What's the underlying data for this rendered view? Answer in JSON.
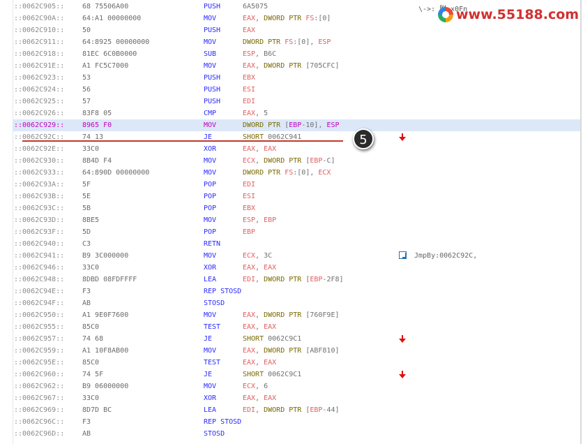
{
  "rows": [
    {
      "addr": "::0062C905::",
      "bytes": "68 75506A00",
      "mn": "PUSH",
      "ops": [
        [
          "num",
          "6A5075"
        ]
      ],
      "mark": ""
    },
    {
      "addr": "::0062C90A::",
      "bytes": "64:A1 00000000",
      "mn": "MOV",
      "ops": [
        [
          "reg",
          "EAX"
        ],
        [
          "num",
          ", "
        ],
        [
          "kw",
          "DWORD PTR "
        ],
        [
          "reg",
          "FS"
        ],
        [
          "num",
          ":[0]"
        ]
      ],
      "mark": ""
    },
    {
      "addr": "::0062C910::",
      "bytes": "50",
      "mn": "PUSH",
      "ops": [
        [
          "reg",
          "EAX"
        ]
      ],
      "mark": ""
    },
    {
      "addr": "::0062C911::",
      "bytes": "64:8925 00000000",
      "mn": "MOV",
      "ops": [
        [
          "kw",
          "DWORD PTR "
        ],
        [
          "reg",
          "FS"
        ],
        [
          "num",
          ":[0], "
        ],
        [
          "reg",
          "ESP"
        ]
      ],
      "mark": ""
    },
    {
      "addr": "::0062C918::",
      "bytes": "81EC 6C0B0000",
      "mn": "SUB",
      "ops": [
        [
          "reg",
          "ESP"
        ],
        [
          "num",
          ", B6C"
        ]
      ],
      "mark": ""
    },
    {
      "addr": "::0062C91E::",
      "bytes": "A1 FC5C7000",
      "mn": "MOV",
      "ops": [
        [
          "reg",
          "EAX"
        ],
        [
          "num",
          ", "
        ],
        [
          "kw",
          "DWORD PTR "
        ],
        [
          "num",
          "[705CFC]"
        ]
      ],
      "mark": ""
    },
    {
      "addr": "::0062C923::",
      "bytes": "53",
      "mn": "PUSH",
      "ops": [
        [
          "reg",
          "EBX"
        ]
      ],
      "mark": ""
    },
    {
      "addr": "::0062C924::",
      "bytes": "56",
      "mn": "PUSH",
      "ops": [
        [
          "reg",
          "ESI"
        ]
      ],
      "mark": ""
    },
    {
      "addr": "::0062C925::",
      "bytes": "57",
      "mn": "PUSH",
      "ops": [
        [
          "reg",
          "EDI"
        ]
      ],
      "mark": ""
    },
    {
      "addr": "::0062C926::",
      "bytes": "83F8 05",
      "mn": "CMP",
      "ops": [
        [
          "reg",
          "EAX"
        ],
        [
          "num",
          ", 5"
        ]
      ],
      "mark": ""
    },
    {
      "addr": "::0062C929::",
      "bytes": "8965 F0",
      "mn": "MOV",
      "ops": [
        [
          "kw",
          "DWORD PTR "
        ],
        [
          "num",
          "["
        ],
        [
          "reg",
          "EBP"
        ],
        [
          "num",
          "-10], "
        ],
        [
          "reg",
          "ESP"
        ]
      ],
      "mark": "",
      "hl": true
    },
    {
      "addr": "::0062C92C::",
      "bytes": "74 13",
      "mn": "JE",
      "ops": [
        [
          "kw",
          "SHORT "
        ],
        [
          "num",
          "0062C941"
        ]
      ],
      "mark": "arrow"
    },
    {
      "addr": "::0062C92E::",
      "bytes": "33C0",
      "mn": "XOR",
      "ops": [
        [
          "reg",
          "EAX"
        ],
        [
          "num",
          ", "
        ],
        [
          "reg",
          "EAX"
        ]
      ],
      "mark": ""
    },
    {
      "addr": "::0062C930::",
      "bytes": "8B4D F4",
      "mn": "MOV",
      "ops": [
        [
          "reg",
          "ECX"
        ],
        [
          "num",
          ", "
        ],
        [
          "kw",
          "DWORD PTR "
        ],
        [
          "num",
          "["
        ],
        [
          "reg",
          "EBP"
        ],
        [
          "num",
          "-C]"
        ]
      ],
      "mark": ""
    },
    {
      "addr": "::0062C933::",
      "bytes": "64:890D 00000000",
      "mn": "MOV",
      "ops": [
        [
          "kw",
          "DWORD PTR "
        ],
        [
          "reg",
          "FS"
        ],
        [
          "num",
          ":[0], "
        ],
        [
          "reg",
          "ECX"
        ]
      ],
      "mark": ""
    },
    {
      "addr": "::0062C93A::",
      "bytes": "5F",
      "mn": "POP",
      "ops": [
        [
          "reg",
          "EDI"
        ]
      ],
      "mark": ""
    },
    {
      "addr": "::0062C93B::",
      "bytes": "5E",
      "mn": "POP",
      "ops": [
        [
          "reg",
          "ESI"
        ]
      ],
      "mark": ""
    },
    {
      "addr": "::0062C93C::",
      "bytes": "5B",
      "mn": "POP",
      "ops": [
        [
          "reg",
          "EBX"
        ]
      ],
      "mark": ""
    },
    {
      "addr": "::0062C93D::",
      "bytes": "8BE5",
      "mn": "MOV",
      "ops": [
        [
          "reg",
          "ESP"
        ],
        [
          "num",
          ", "
        ],
        [
          "reg",
          "EBP"
        ]
      ],
      "mark": ""
    },
    {
      "addr": "::0062C93F::",
      "bytes": "5D",
      "mn": "POP",
      "ops": [
        [
          "reg",
          "EBP"
        ]
      ],
      "mark": ""
    },
    {
      "addr": "::0062C940::",
      "bytes": "C3",
      "mn": "RETN",
      "ops": [],
      "mark": ""
    },
    {
      "addr": "::0062C941::",
      "bytes": "B9 3C000000",
      "mn": "MOV",
      "ops": [
        [
          "reg",
          "ECX"
        ],
        [
          "num",
          ", 3C"
        ]
      ],
      "mark": "jmpby",
      "cmt": "JmpBy:0062C92C,"
    },
    {
      "addr": "::0062C946::",
      "bytes": "33C0",
      "mn": "XOR",
      "ops": [
        [
          "reg",
          "EAX"
        ],
        [
          "num",
          ", "
        ],
        [
          "reg",
          "EAX"
        ]
      ],
      "mark": ""
    },
    {
      "addr": "::0062C948::",
      "bytes": "8DBD 08FDFFFF",
      "mn": "LEA",
      "ops": [
        [
          "reg",
          "EDI"
        ],
        [
          "num",
          ", "
        ],
        [
          "kw",
          "DWORD PTR "
        ],
        [
          "num",
          "["
        ],
        [
          "reg",
          "EBP"
        ],
        [
          "num",
          "-2F8]"
        ]
      ],
      "mark": ""
    },
    {
      "addr": "::0062C94E::",
      "bytes": "F3",
      "mn": "REP STOSD",
      "ops": [],
      "mark": ""
    },
    {
      "addr": "::0062C94F::",
      "bytes": "AB",
      "mn": "STOSD",
      "ops": [],
      "mark": ""
    },
    {
      "addr": "::0062C950::",
      "bytes": "A1 9E0F7600",
      "mn": "MOV",
      "ops": [
        [
          "reg",
          "EAX"
        ],
        [
          "num",
          ", "
        ],
        [
          "kw",
          "DWORD PTR "
        ],
        [
          "num",
          "[760F9E]"
        ]
      ],
      "mark": ""
    },
    {
      "addr": "::0062C955::",
      "bytes": "85C0",
      "mn": "TEST",
      "ops": [
        [
          "reg",
          "EAX"
        ],
        [
          "num",
          ", "
        ],
        [
          "reg",
          "EAX"
        ]
      ],
      "mark": ""
    },
    {
      "addr": "::0062C957::",
      "bytes": "74 68",
      "mn": "JE",
      "ops": [
        [
          "kw",
          "SHORT "
        ],
        [
          "num",
          "0062C9C1"
        ]
      ],
      "mark": "arrow"
    },
    {
      "addr": "::0062C959::",
      "bytes": "A1 10F8AB00",
      "mn": "MOV",
      "ops": [
        [
          "reg",
          "EAX"
        ],
        [
          "num",
          ", "
        ],
        [
          "kw",
          "DWORD PTR "
        ],
        [
          "num",
          "[ABF810]"
        ]
      ],
      "mark": ""
    },
    {
      "addr": "::0062C95E::",
      "bytes": "85C0",
      "mn": "TEST",
      "ops": [
        [
          "reg",
          "EAX"
        ],
        [
          "num",
          ", "
        ],
        [
          "reg",
          "EAX"
        ]
      ],
      "mark": ""
    },
    {
      "addr": "::0062C960::",
      "bytes": "74 5F",
      "mn": "JE",
      "ops": [
        [
          "kw",
          "SHORT "
        ],
        [
          "num",
          "0062C9C1"
        ]
      ],
      "mark": "arrow"
    },
    {
      "addr": "::0062C962::",
      "bytes": "B9 06000000",
      "mn": "MOV",
      "ops": [
        [
          "reg",
          "ECX"
        ],
        [
          "num",
          ", 6"
        ]
      ],
      "mark": ""
    },
    {
      "addr": "::0062C967::",
      "bytes": "33C0",
      "mn": "XOR",
      "ops": [
        [
          "reg",
          "EAX"
        ],
        [
          "num",
          ", "
        ],
        [
          "reg",
          "EAX"
        ]
      ],
      "mark": ""
    },
    {
      "addr": "::0062C969::",
      "bytes": "8D7D BC",
      "mn": "LEA",
      "ops": [
        [
          "reg",
          "EDI"
        ],
        [
          "num",
          ", "
        ],
        [
          "kw",
          "DWORD PTR "
        ],
        [
          "num",
          "["
        ],
        [
          "reg",
          "EBP"
        ],
        [
          "num",
          "-44]"
        ]
      ],
      "mark": ""
    },
    {
      "addr": "::0062C96C::",
      "bytes": "F3",
      "mn": "REP STOSD",
      "ops": [],
      "mark": ""
    },
    {
      "addr": "::0062C96D::",
      "bytes": "AB",
      "mn": "STOSD",
      "ops": [],
      "mark": ""
    }
  ],
  "top_comment": "\\->: 附 x0Fn",
  "step_badge": "5",
  "watermark": "www.55188.com",
  "colors": {
    "highlight": "#dce8f8",
    "underline": "#c0392b",
    "arrow": "#e01010"
  }
}
